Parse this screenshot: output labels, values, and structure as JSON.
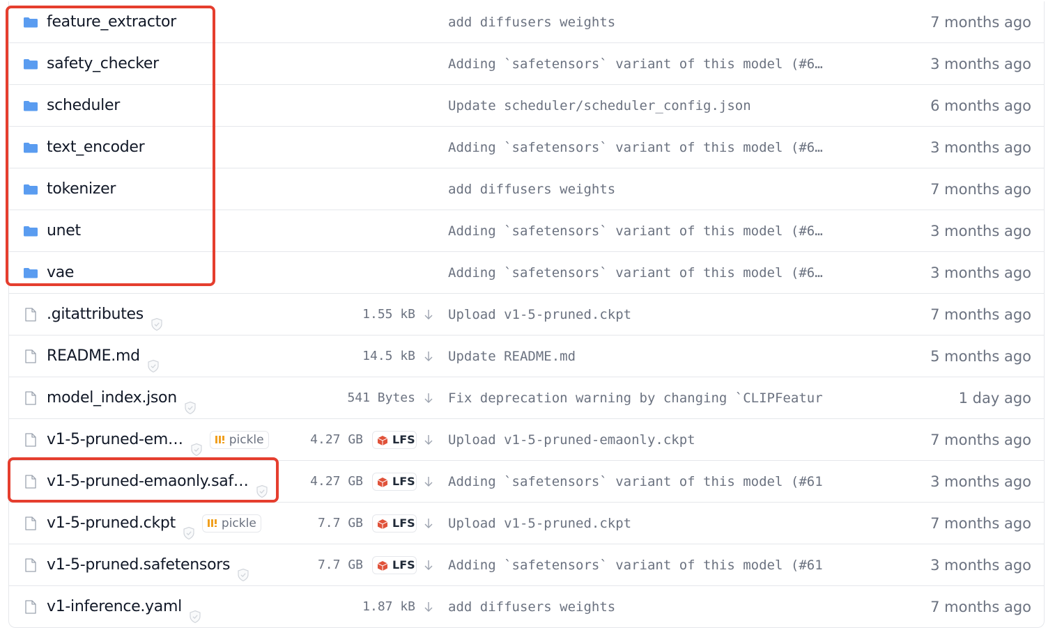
{
  "files": [
    {
      "name": "feature_extractor",
      "type": "folder",
      "commit": "add diffusers weights",
      "date": "7 months ago"
    },
    {
      "name": "safety_checker",
      "type": "folder",
      "commit": "Adding `safetensors` variant of this model (#6…",
      "date": "3 months ago"
    },
    {
      "name": "scheduler",
      "type": "folder",
      "commit": "Update scheduler/scheduler_config.json",
      "date": "6 months ago"
    },
    {
      "name": "text_encoder",
      "type": "folder",
      "commit": "Adding `safetensors` variant of this model (#6…",
      "date": "3 months ago"
    },
    {
      "name": "tokenizer",
      "type": "folder",
      "commit": "add diffusers weights",
      "date": "7 months ago"
    },
    {
      "name": "unet",
      "type": "folder",
      "commit": "Adding `safetensors` variant of this model (#6…",
      "date": "3 months ago"
    },
    {
      "name": "vae",
      "type": "folder",
      "commit": "Adding `safetensors` variant of this model (#6…",
      "date": "3 months ago"
    },
    {
      "name": ".gitattributes",
      "type": "file",
      "size": "1.55 kB",
      "commit": "Upload v1-5-pruned.ckpt",
      "date": "7 months ago"
    },
    {
      "name": "README.md",
      "type": "file",
      "size": "14.5 kB",
      "commit": "Update README.md",
      "date": "5 months ago"
    },
    {
      "name": "model_index.json",
      "type": "file",
      "size": "541 Bytes",
      "commit": "Fix deprecation warning by changing `CLIPFeatur",
      "date": "1 day ago"
    },
    {
      "name": "v1-5-pruned-em…",
      "type": "file",
      "pickle": "pickle",
      "size": "4.27 GB",
      "lfs": "LFS",
      "commit": "Upload v1-5-pruned-emaonly.ckpt",
      "date": "7 months ago"
    },
    {
      "name": "v1-5-pruned-emaonly.saf…",
      "type": "file",
      "size": "4.27 GB",
      "lfs": "LFS",
      "commit": "Adding `safetensors` variant of this model (#61",
      "date": "3 months ago"
    },
    {
      "name": "v1-5-pruned.ckpt",
      "type": "file",
      "pickle": "pickle",
      "size": "7.7 GB",
      "lfs": "LFS",
      "commit": "Upload v1-5-pruned.ckpt",
      "date": "7 months ago"
    },
    {
      "name": "v1-5-pruned.safetensors",
      "type": "file",
      "size": "7.7 GB",
      "lfs": "LFS",
      "commit": "Adding `safetensors` variant of this model (#61",
      "date": "3 months ago"
    },
    {
      "name": "v1-inference.yaml",
      "type": "file",
      "size": "1.87 kB",
      "commit": "add diffusers weights",
      "date": "7 months ago"
    }
  ],
  "colors": {
    "folder": "#5a9cf0",
    "highlight": "#e53e2e",
    "lfs_cube": "#e0523a",
    "pickle_icon": "#f0a020"
  },
  "icons": {
    "folder": "folder-icon",
    "file": "file-icon",
    "safe": "shield-check-icon",
    "download": "download-arrow-icon",
    "lfs": "lfs-cube-icon",
    "pickle": "pickle-icon"
  }
}
